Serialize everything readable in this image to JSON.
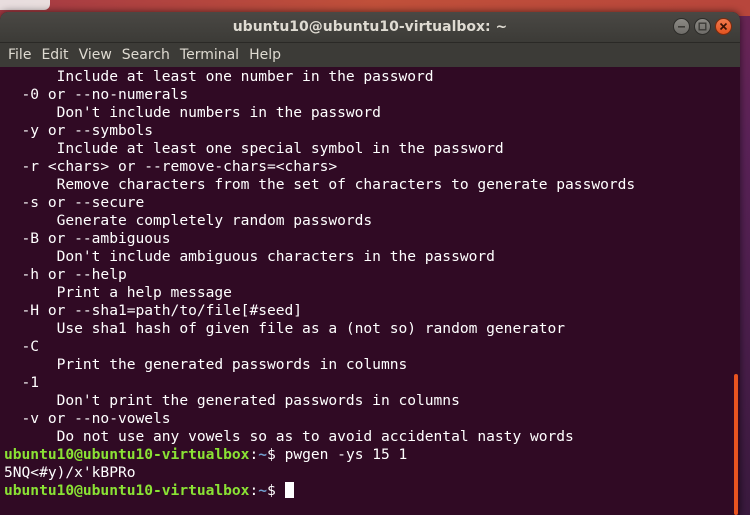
{
  "window": {
    "title": "ubuntu10@ubuntu10-virtualbox: ~",
    "controls": [
      "minimize-icon",
      "maximize-icon",
      "close-icon"
    ]
  },
  "menubar": {
    "items": [
      "File",
      "Edit",
      "View",
      "Search",
      "Terminal",
      "Help"
    ]
  },
  "terminal": {
    "output_lines": [
      "      Include at least one number in the password",
      "  -0 or --no-numerals",
      "      Don't include numbers in the password",
      "  -y or --symbols",
      "      Include at least one special symbol in the password",
      "  -r <chars> or --remove-chars=<chars>",
      "      Remove characters from the set of characters to generate passwords",
      "  -s or --secure",
      "      Generate completely random passwords",
      "  -B or --ambiguous",
      "      Don't include ambiguous characters in the password",
      "  -h or --help",
      "      Print a help message",
      "  -H or --sha1=path/to/file[#seed]",
      "      Use sha1 hash of given file as a (not so) random generator",
      "  -C",
      "      Print the generated passwords in columns",
      "  -1",
      "      Don't print the generated passwords in columns",
      "  -v or --no-vowels",
      "      Do not use any vowels so as to avoid accidental nasty words"
    ],
    "prompt": {
      "user_host": "ubuntu10@ubuntu10-virtualbox",
      "separator": ":",
      "path": "~",
      "symbol": "$ "
    },
    "command": "pwgen -ys 15 1",
    "result": "5NQ<#y)/x'kBPRo",
    "colors": {
      "background": "#300a24",
      "text": "#ffffff",
      "prompt_user": "#8ae234",
      "prompt_path": "#729fcf",
      "scrollbar_thumb": "#e95420"
    }
  }
}
